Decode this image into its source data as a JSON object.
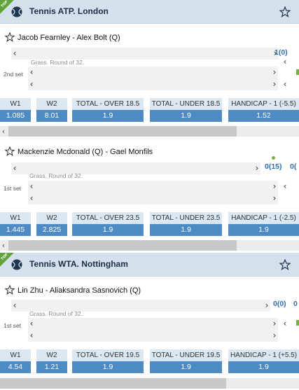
{
  "leagues": [
    {
      "top_badge": "TOP",
      "sport_icon": "tennis-ball-icon",
      "title": "Tennis ATP. London",
      "matches": [
        {
          "teams": "Jacob Fearnley - Alex Bolt (Q)",
          "info": "Grass. Round of 32.",
          "set_label": "2nd set",
          "score": "1(0)",
          "odds": [
            {
              "label": "W1",
              "value": "1.085"
            },
            {
              "label": "W2",
              "value": "8.01"
            },
            {
              "label": "TOTAL - OVER 18.5",
              "value": "1.9"
            },
            {
              "label": "TOTAL - UNDER 18.5",
              "value": "1.9"
            },
            {
              "label": "HANDICAP - 1 (-5.5)",
              "value": "1.52"
            }
          ]
        },
        {
          "teams": "Mackenzie Mcdonald (Q) - Gael Monfils",
          "info": "Grass. Round of 32.",
          "set_label": "1st set",
          "score": "0(15)",
          "score_extra": "0(",
          "odds": [
            {
              "label": "W1",
              "value": "1.445"
            },
            {
              "label": "W2",
              "value": "2.825"
            },
            {
              "label": "TOTAL - OVER 23.5",
              "value": "1.9"
            },
            {
              "label": "TOTAL - UNDER 23.5",
              "value": "1.9"
            },
            {
              "label": "HANDICAP - 1 (-2.5)",
              "value": "1.9"
            }
          ]
        }
      ]
    },
    {
      "top_badge": "TOP",
      "sport_icon": "tennis-ball-icon",
      "title": "Tennis WTA. Nottingham",
      "matches": [
        {
          "teams": "Lin Zhu - Aliaksandra Sasnovich (Q)",
          "info": "Grass. Round of 32.",
          "set_label": "1st set",
          "score": "0(0)",
          "score_extra": "0",
          "odds": [
            {
              "label": "W1",
              "value": "4.54"
            },
            {
              "label": "W2",
              "value": "1.21"
            },
            {
              "label": "TOTAL - OVER 19.5",
              "value": "1.9"
            },
            {
              "label": "TOTAL - UNDER 19.5",
              "value": "1.9"
            },
            {
              "label": "HANDICAP - 1 (+5.5)",
              "value": "1.9"
            }
          ]
        }
      ]
    }
  ],
  "colors": {
    "header_bg": "#d4e1ec",
    "odds_header_bg": "#dbe7f1",
    "odds_value_bg": "#4e8ac4",
    "score_blue": "#2f6fb0",
    "top_green": "#5fa33a"
  }
}
